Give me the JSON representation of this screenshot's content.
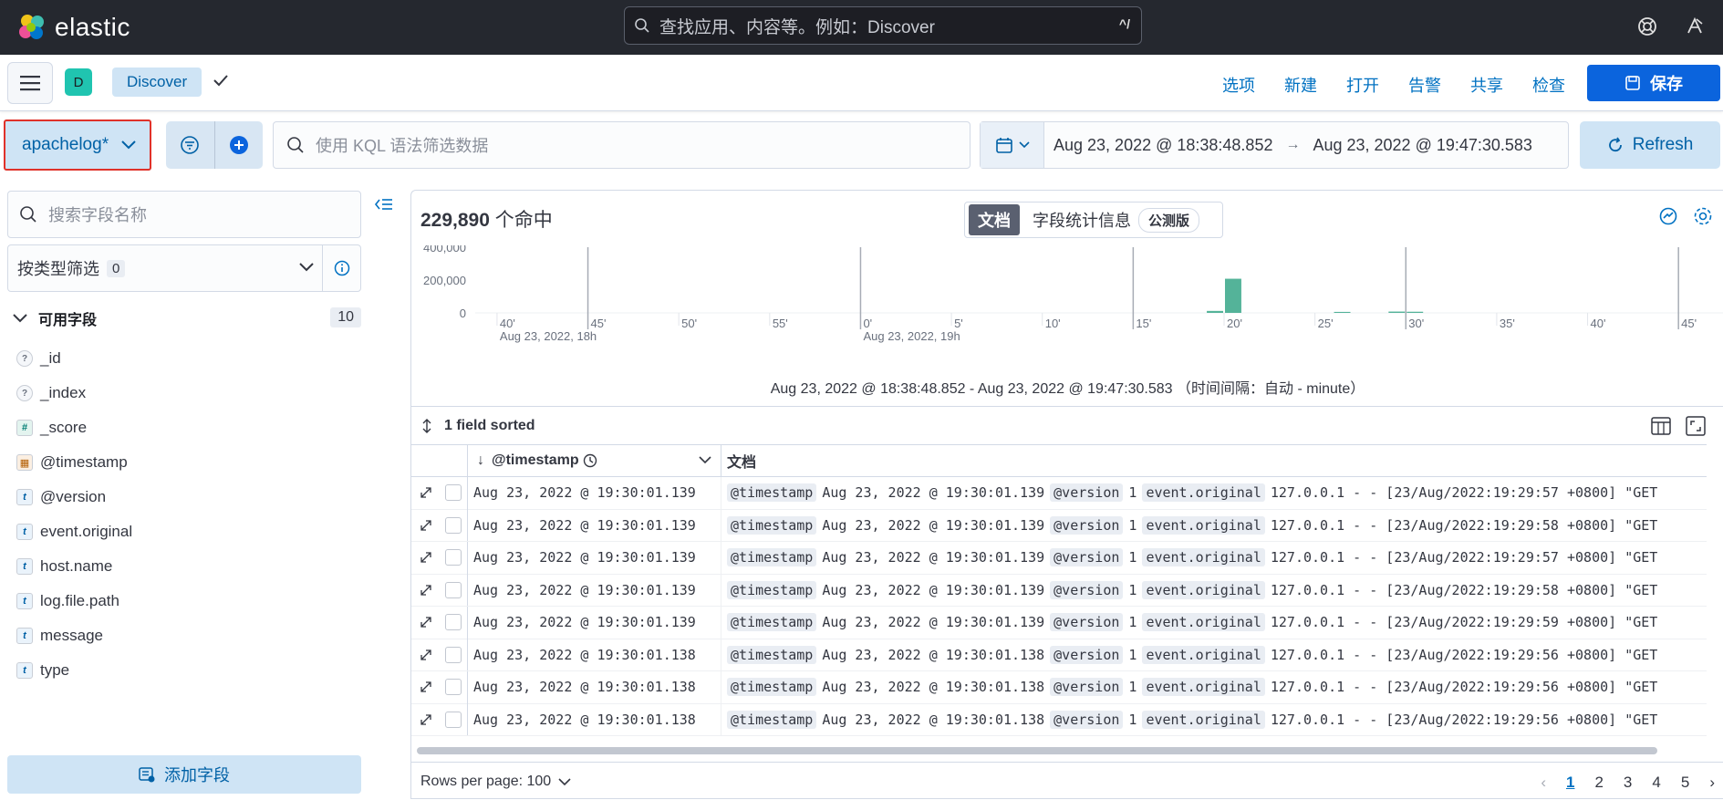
{
  "topbar": {
    "brand": "elastic",
    "search_placeholder": "查找应用、内容等。例如：Discover",
    "shortcut": "^/"
  },
  "subbar": {
    "space_initial": "D",
    "breadcrumb": "Discover",
    "links": [
      "选项",
      "新建",
      "打开",
      "告警",
      "共享",
      "检查"
    ],
    "save_label": "保存"
  },
  "query": {
    "index_pattern": "apachelog*",
    "kql_placeholder": "使用 KQL 语法筛选数据",
    "date_start": "Aug 23, 2022 @ 18:38:48.852",
    "date_end": "Aug 23, 2022 @ 19:47:30.583",
    "refresh_label": "Refresh"
  },
  "sidebar": {
    "search_placeholder": "搜索字段名称",
    "type_filter_label": "按类型筛选",
    "type_filter_count": "0",
    "available_label": "可用字段",
    "available_count": "10",
    "fields": [
      {
        "type": "?",
        "name": "_id"
      },
      {
        "type": "?",
        "name": "_index"
      },
      {
        "type": "#",
        "name": "_score"
      },
      {
        "type": "date",
        "name": "@timestamp"
      },
      {
        "type": "t",
        "name": "@version"
      },
      {
        "type": "t",
        "name": "event.original"
      },
      {
        "type": "t",
        "name": "host.name"
      },
      {
        "type": "t",
        "name": "log.file.path"
      },
      {
        "type": "t",
        "name": "message"
      },
      {
        "type": "t",
        "name": "type"
      }
    ],
    "add_field_label": "添加字段"
  },
  "main": {
    "hits_count": "229,890",
    "hits_suffix": "个命中",
    "tab_documents": "文档",
    "tab_field_stats": "字段统计信息",
    "beta_label": "公测版",
    "chart_caption": "Aug 23, 2022 @ 18:38:48.852 - Aug 23, 2022 @ 19:47:30.583  （时间间隔：自动 - minute）",
    "sort_label": "1 field sorted",
    "col_timestamp": "@timestamp",
    "col_document": "文档",
    "rows_per_page": "Rows per page: 100",
    "pages": [
      "1",
      "2",
      "3",
      "4",
      "5"
    ]
  },
  "chart_data": {
    "type": "bar",
    "x_tick_labels": [
      "40'",
      "45'",
      "50'",
      "55'",
      "0'",
      "5'",
      "10'",
      "15'",
      "20'",
      "25'",
      "30'",
      "35'",
      "40'",
      "45'"
    ],
    "x_sub_labels": [
      "Aug 23, 2022, 18h",
      "Aug 23, 2022, 19h"
    ],
    "y_tick_labels": [
      "400,000",
      "200,000",
      "0"
    ],
    "ylim": [
      0,
      400000
    ],
    "x_range_minutes": [
      38.8,
      107.5
    ],
    "bars": [
      {
        "minute": 79,
        "value": 12000
      },
      {
        "minute": 80,
        "value": 208000
      },
      {
        "minute": 86,
        "value": 6000
      },
      {
        "minute": 89,
        "value": 8000
      },
      {
        "minute": 90,
        "value": 7000
      }
    ],
    "bar_color": "#54b399"
  },
  "rows": [
    {
      "ts": "Aug 23, 2022 @ 19:30:01.139",
      "log": "127.0.0.1 - - [23/Aug/2022:19:29:57 +0800] \"GET"
    },
    {
      "ts": "Aug 23, 2022 @ 19:30:01.139",
      "log": "127.0.0.1 - - [23/Aug/2022:19:29:58 +0800] \"GET"
    },
    {
      "ts": "Aug 23, 2022 @ 19:30:01.139",
      "log": "127.0.0.1 - - [23/Aug/2022:19:29:57 +0800] \"GET"
    },
    {
      "ts": "Aug 23, 2022 @ 19:30:01.139",
      "log": "127.0.0.1 - - [23/Aug/2022:19:29:58 +0800] \"GET"
    },
    {
      "ts": "Aug 23, 2022 @ 19:30:01.139",
      "log": "127.0.0.1 - - [23/Aug/2022:19:29:59 +0800] \"GET"
    },
    {
      "ts": "Aug 23, 2022 @ 19:30:01.138",
      "log": "127.0.0.1 - - [23/Aug/2022:19:29:56 +0800] \"GET"
    },
    {
      "ts": "Aug 23, 2022 @ 19:30:01.138",
      "log": "127.0.0.1 - - [23/Aug/2022:19:29:56 +0800] \"GET"
    },
    {
      "ts": "Aug 23, 2022 @ 19:30:01.138",
      "log": "127.0.0.1 - - [23/Aug/2022:19:29:56 +0800] \"GET"
    }
  ],
  "row_keys": {
    "timestamp": "@timestamp",
    "version": "@version",
    "version_value": "1",
    "original": "event.original"
  },
  "colors": {
    "topbar": "#25282f",
    "accent": "#0b64dd",
    "highlight": "#e0322a"
  }
}
